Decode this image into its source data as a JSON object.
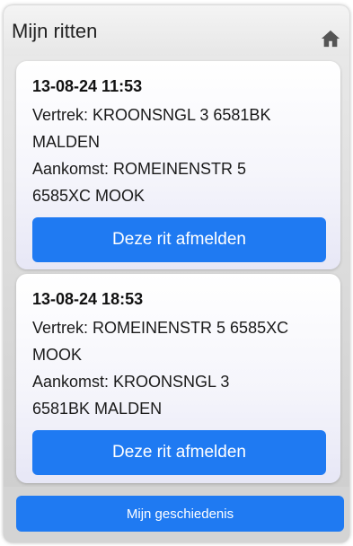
{
  "header": {
    "title": "Mijn ritten",
    "icon": "home-icon"
  },
  "rides": [
    {
      "datetime": "13-08-24 11:53",
      "departure_line1": "Vertrek: KROONSNGL 3 6581BK",
      "departure_line2": "MALDEN",
      "arrival_line1": "Aankomst: ROMEINENSTR 5",
      "arrival_line2": "6585XC MOOK",
      "cancel_label": "Deze rit afmelden"
    },
    {
      "datetime": "13-08-24 18:53",
      "departure_line1": "Vertrek: ROMEINENSTR 5 6585XC",
      "departure_line2": "MOOK",
      "arrival_line1": "Aankomst: KROONSNGL 3",
      "arrival_line2": "6581BK MALDEN",
      "cancel_label": "Deze rit afmelden"
    }
  ],
  "footer": {
    "history_label": "Mijn geschiedenis"
  },
  "colors": {
    "primary_button": "#1f7af2",
    "background": "#c9c9c9"
  }
}
